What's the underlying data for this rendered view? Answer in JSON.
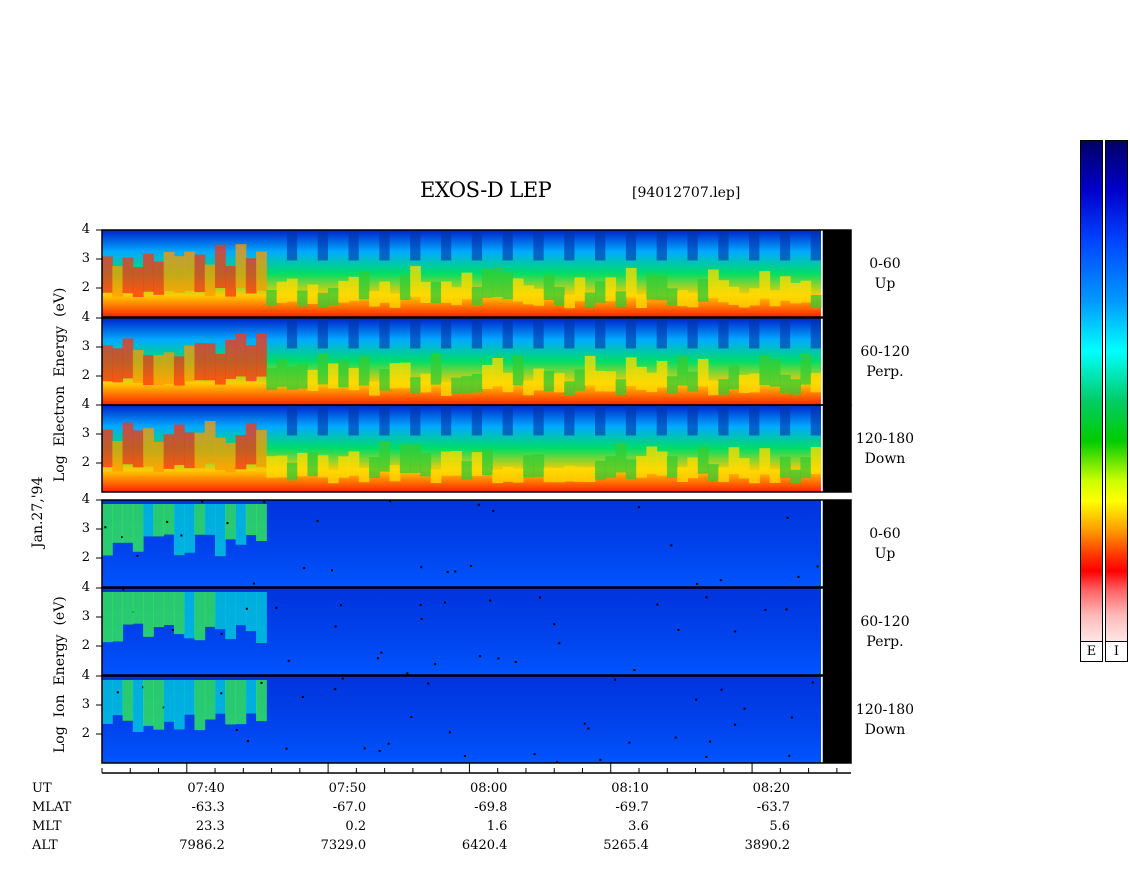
{
  "title": "EXOS-D LEP",
  "file_label": "[94012707.lep]",
  "date_label": "Jan.27,'94",
  "chart_data": {
    "type": "heatmap",
    "groups": [
      {
        "label_lines": [
          "Log",
          "Electron",
          "Energy",
          "(eV)"
        ],
        "panels": [
          {
            "channel": "0-60",
            "direction": "Up"
          },
          {
            "channel": "60-120",
            "direction": "Perp."
          },
          {
            "channel": "120-180",
            "direction": "Down"
          }
        ]
      },
      {
        "label_lines": [
          "Log",
          "Ion",
          "Energy",
          "(eV)"
        ],
        "panels": [
          {
            "channel": "0-60",
            "direction": "Up"
          },
          {
            "channel": "60-120",
            "direction": "Perp."
          },
          {
            "channel": "120-180",
            "direction": "Down"
          }
        ]
      }
    ],
    "y_ticks": [
      "4",
      "3",
      "2"
    ],
    "ylim": [
      1,
      4
    ],
    "x_range": [
      "07:34",
      "08:27"
    ],
    "data_gap_after": "08:25",
    "time_axis": {
      "row_labels": [
        "UT",
        "MLAT",
        "MLT",
        "ALT"
      ],
      "columns": [
        {
          "UT": "07:40",
          "MLAT": "-63.3",
          "MLT": "23.3",
          "ALT": "7986.2"
        },
        {
          "UT": "07:50",
          "MLAT": "-67.0",
          "MLT": "0.2",
          "ALT": "7329.0"
        },
        {
          "UT": "08:00",
          "MLAT": "-69.8",
          "MLT": "1.6",
          "ALT": "6420.4"
        },
        {
          "UT": "08:10",
          "MLAT": "-69.7",
          "MLT": "3.6",
          "ALT": "5265.4"
        },
        {
          "UT": "08:20",
          "MLAT": "-63.7",
          "MLT": "5.6",
          "ALT": "3890.2"
        }
      ]
    },
    "colorbars": [
      {
        "label": "E",
        "colors": [
          "#000066",
          "#0000cc",
          "#0099ff",
          "#00ffff",
          "#00cc00",
          "#ffff00",
          "#ff9900",
          "#ff0000",
          "#ffe6e6"
        ]
      },
      {
        "label": "I",
        "colors": [
          "#000066",
          "#0000cc",
          "#0099ff",
          "#00ffff",
          "#00cc00",
          "#ffff00",
          "#ff9900",
          "#ff0000",
          "#ffe6e6"
        ]
      }
    ]
  }
}
